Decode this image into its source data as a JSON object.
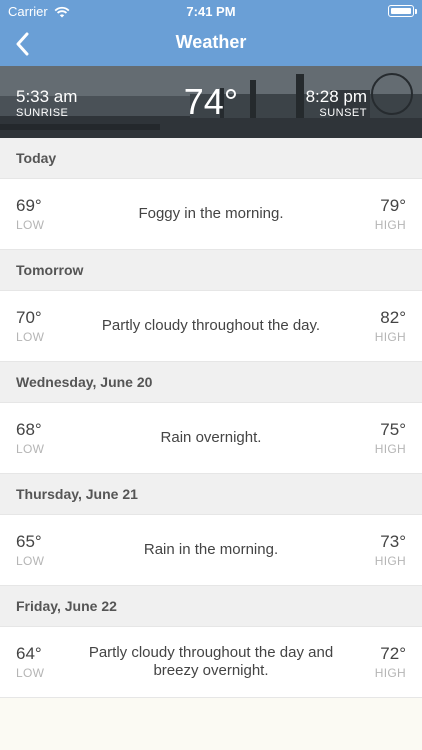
{
  "status_bar": {
    "carrier": "Carrier",
    "time": "7:41 PM"
  },
  "navbar": {
    "title": "Weather",
    "back_icon": "chevron-left-icon"
  },
  "current": {
    "sunrise_time": "5:33 am",
    "sunrise_label": "SUNRISE",
    "temperature": "74°",
    "sunset_time": "8:28 pm",
    "sunset_label": "SUNSET"
  },
  "forecast": [
    {
      "day": "Today",
      "low": "69°",
      "low_label": "LOW",
      "summary": "Foggy in the morning.",
      "high": "79°",
      "high_label": "HIGH"
    },
    {
      "day": "Tomorrow",
      "low": "70°",
      "low_label": "LOW",
      "summary": "Partly cloudy throughout the day.",
      "high": "82°",
      "high_label": "HIGH"
    },
    {
      "day": "Wednesday, June 20",
      "low": "68°",
      "low_label": "LOW",
      "summary": "Rain overnight.",
      "high": "75°",
      "high_label": "HIGH"
    },
    {
      "day": "Thursday, June 21",
      "low": "65°",
      "low_label": "LOW",
      "summary": "Rain in the morning.",
      "high": "73°",
      "high_label": "HIGH"
    },
    {
      "day": "Friday, June 22",
      "low": "64°",
      "low_label": "LOW",
      "summary": "Partly cloudy throughout the day and breezy overnight.",
      "high": "72°",
      "high_label": "HIGH"
    }
  ],
  "colors": {
    "nav_bar": "#6a9fd6",
    "header_bg": "#f0f0f0",
    "row_bg": "#ffffff",
    "label_gray": "#b5b5b5"
  }
}
